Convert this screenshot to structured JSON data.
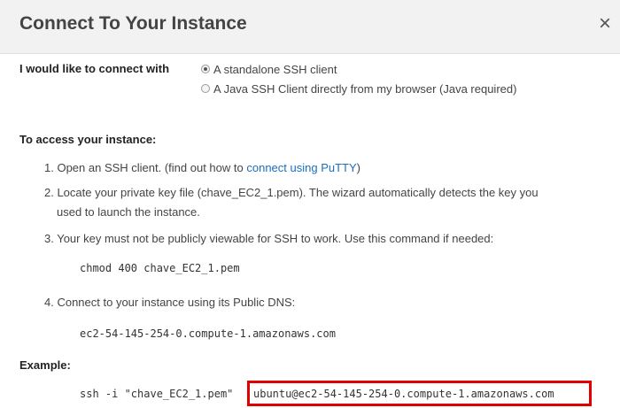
{
  "dialog": {
    "title": "Connect To Your Instance",
    "close_glyph": "×"
  },
  "connect_with": {
    "label": "I would like to connect with",
    "options": [
      {
        "label": "A standalone SSH client",
        "selected": true
      },
      {
        "label": "A Java SSH Client directly from my browser (Java required)",
        "selected": false
      }
    ]
  },
  "access": {
    "heading": "To access your instance:",
    "step1_prefix": "1. Open an SSH client. (find out how to ",
    "step1_link": "connect using PuTTY",
    "step1_suffix": ")",
    "step2_line1": "2. Locate your private key file (chave_EC2_1.pem). The wizard automatically detects the key you",
    "step2_line2": "used to launch the instance.",
    "step3": "3. Your key must not be publicly viewable for SSH to work. Use this command if needed:",
    "chmod_command": "chmod 400 chave_EC2_1.pem",
    "step4": "4. Connect to your instance using its Public DNS:",
    "public_dns": "ec2-54-145-254-0.compute-1.amazonaws.com"
  },
  "example": {
    "heading": "Example:",
    "command_prefix": "ssh -i \"chave_EC2_1.pem\"",
    "command_target": "ubuntu@ec2-54-145-254-0.compute-1.amazonaws.com"
  }
}
